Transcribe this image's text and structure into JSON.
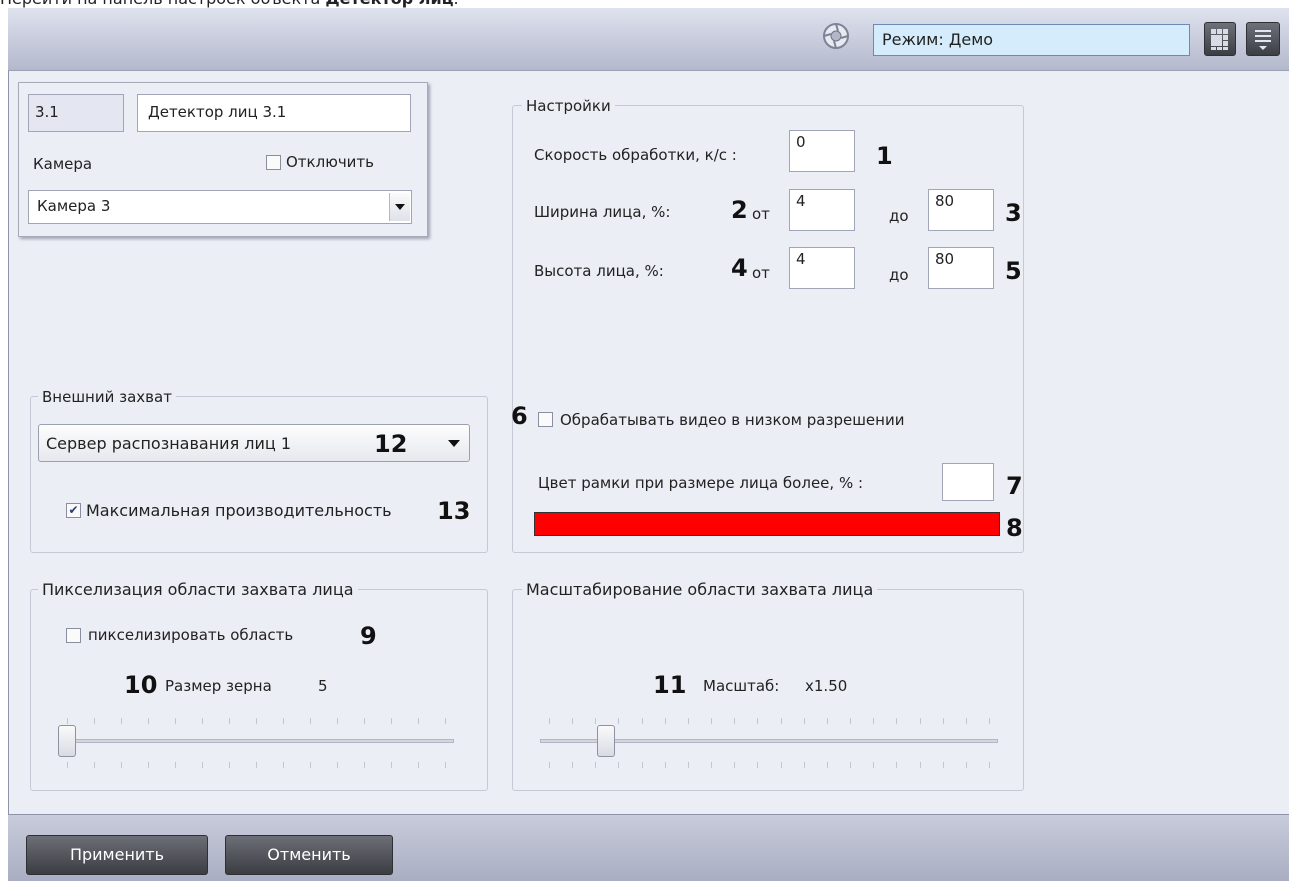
{
  "caption": {
    "prefix": "Перейти на панель настроек объекта ",
    "bold": "Детектор лиц",
    "suffix": "."
  },
  "header": {
    "mode_text": "Режим: Демо"
  },
  "object": {
    "id": "3.1",
    "name": "Детектор лиц 3.1",
    "camera_label": "Камера",
    "disable_label": "Отключить",
    "disable_checked": false,
    "camera_value": "Камера 3"
  },
  "settings": {
    "title": "Настройки",
    "speed_label": "Скорость обработки, к/с :",
    "speed_value": "0",
    "width_label": "Ширина лица, %:",
    "width_from_label": "от",
    "width_from": "4",
    "width_to_label": "до",
    "width_to": "80",
    "height_label": "Высота лица, %:",
    "height_from_label": "от",
    "height_from": "4",
    "height_to_label": "до",
    "height_to": "80",
    "lowres_label": "Обрабатывать видео в низком разрешении",
    "lowres_checked": false,
    "frame_color_label": "Цвет рамки при размере лица более, % :",
    "frame_color_value": "",
    "color_bar": "#ff0000"
  },
  "external": {
    "title": "Внешний захват",
    "server_value": "Сервер распознавания лиц 1",
    "maxperf_label": "Максимальная производительность",
    "maxperf_checked": true
  },
  "pixel": {
    "title": "Пикселизация области захвата лица",
    "checkbox_label": "пикселизировать область",
    "checked": false,
    "grain_label": "Размер зерна",
    "grain_value": "5",
    "slider_fraction": 0.0
  },
  "scale": {
    "title": "Масштабирование области захвата лица",
    "label": "Масштаб:",
    "value": "x1.50",
    "slider_fraction": 0.13
  },
  "callouts": {
    "n1": "1",
    "n2": "2",
    "n3": "3",
    "n4": "4",
    "n5": "5",
    "n6": "6",
    "n7": "7",
    "n8": "8",
    "n9": "9",
    "n10": "10",
    "n11": "11",
    "n12": "12",
    "n13": "13"
  },
  "buttons": {
    "apply": "Применить",
    "cancel": "Отменить"
  },
  "icons": {
    "mode": "camera-lens-icon",
    "layout": "grid-layout-icon",
    "menu": "menu-icon",
    "dropdown": "triangle-down-icon"
  }
}
